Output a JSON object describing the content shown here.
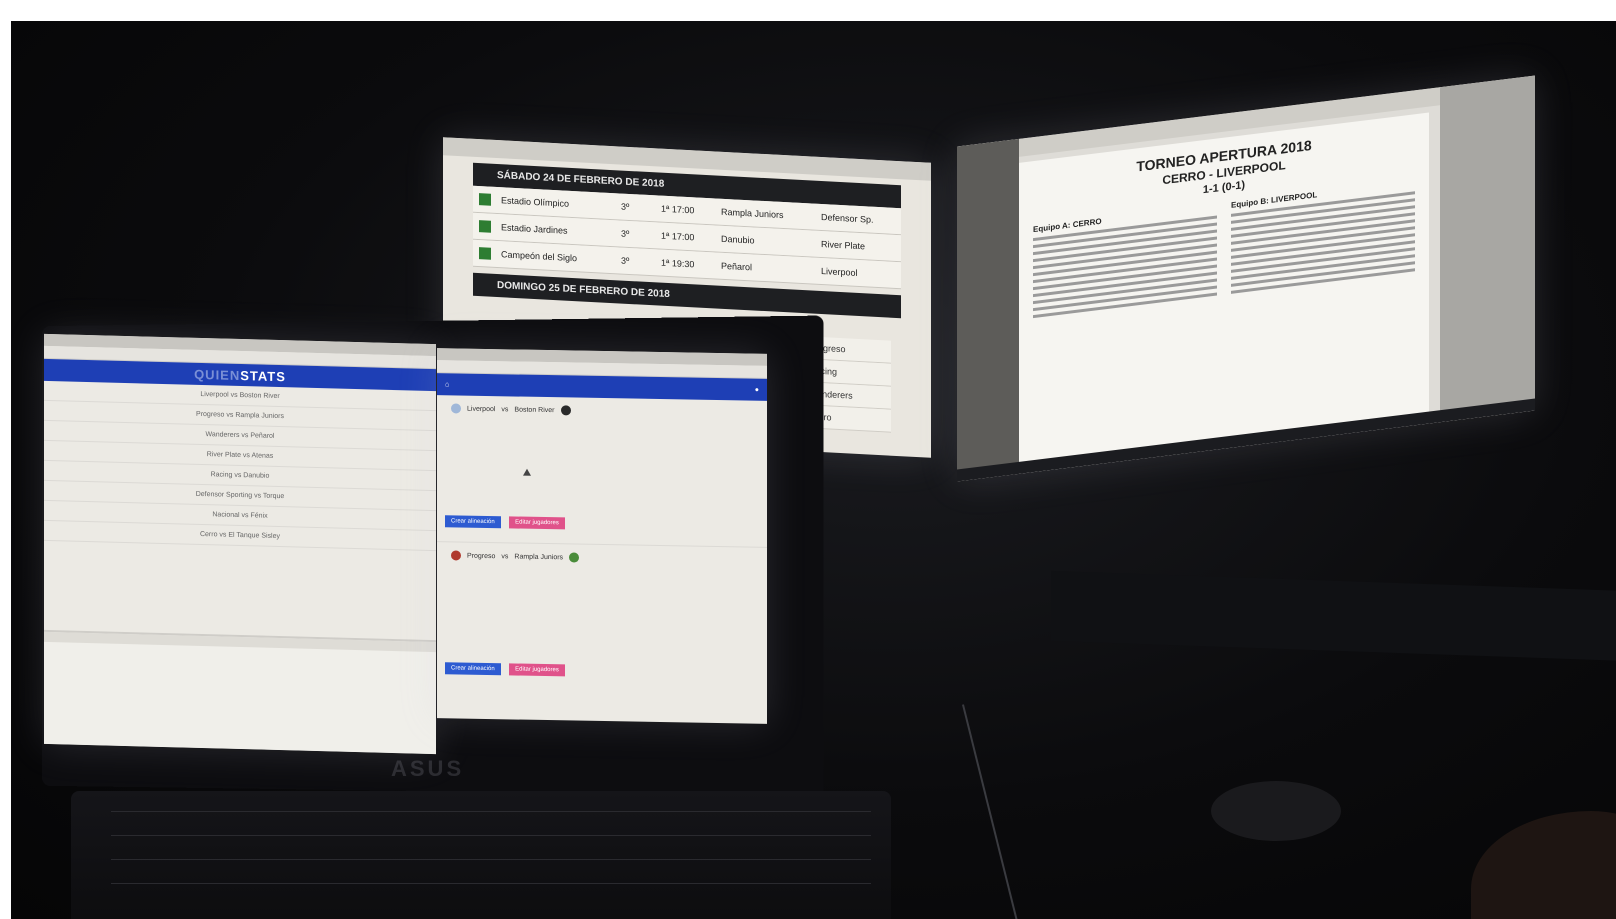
{
  "middle_monitor": {
    "day1_header": "SÁBADO 24 DE FEBRERO DE 2018",
    "day2_header": "DOMINGO 25 DE FEBRERO DE 2018",
    "fixtures": [
      {
        "venue": "Estadio Olímpico",
        "round": "3º",
        "time": "1ª  17:00",
        "home": "Rampla Juniors",
        "away": "Defensor Sp."
      },
      {
        "venue": "Estadio Jardines",
        "round": "3º",
        "time": "1ª  17:00",
        "home": "Danubio",
        "away": "River Plate"
      },
      {
        "venue": "Campeón del Siglo",
        "round": "3º",
        "time": "1ª  19:30",
        "home": "Peñarol",
        "away": "Liverpool"
      }
    ],
    "side_menu": [
      "Progreso",
      "Racing",
      "Wanderers",
      "Cerro"
    ]
  },
  "right_monitor": {
    "title": "TORNEO APERTURA 2018",
    "match": "CERRO - LIVERPOOL",
    "score": "1-1 (0-1)",
    "home_column": "Equipo A: CERRO",
    "away_column": "Equipo B: LIVERPOOL"
  },
  "laptop_left": {
    "brand_first": "QUIEN",
    "brand_second": "STATS",
    "matches": [
      "Liverpool vs Boston River",
      "Progreso vs Rampla Juniors",
      "Wanderers vs Peñarol",
      "River Plate vs Atenas",
      "Racing vs Danubio",
      "Defensor Sporting vs Torque",
      "Nacional vs Fénix",
      "Cerro vs El Tanque Sisley"
    ]
  },
  "laptop_right": {
    "match1_home": "Liverpool",
    "match1_away": "Boston River",
    "match2_home": "Progreso",
    "match2_away": "Rampla Juniors",
    "button_primary": "Crear alineación",
    "button_secondary": "Editar jugadores",
    "vs": "vs"
  },
  "laptop_brand": "ASUS"
}
